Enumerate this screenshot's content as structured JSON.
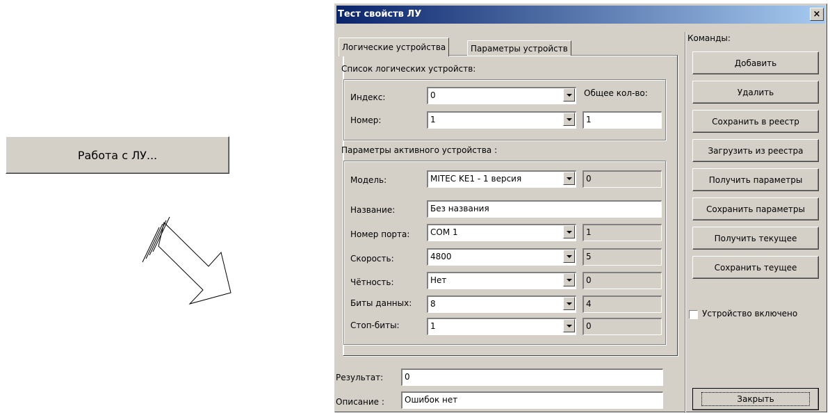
{
  "outer_button": {
    "label": "Работа с ЛУ..."
  },
  "window": {
    "title": "Тест свойств ЛУ",
    "close_glyph": "×"
  },
  "tabs": [
    {
      "label": "Логические устройства",
      "active": true
    },
    {
      "label": "Параметры устройств",
      "active": false
    }
  ],
  "device_list": {
    "title": "Список логических устройств:",
    "index_label": "Индекс:",
    "index_value": "0",
    "number_label": "Номер:",
    "number_value": "1",
    "total_label": "Общее кол-во:",
    "total_value": "1"
  },
  "active_params": {
    "title": "Параметры активного устройства :",
    "model": {
      "label": "Модель:",
      "value": "MITEC KE1 - 1 версия",
      "code": "0"
    },
    "name": {
      "label": "Название:",
      "value": "Без названия"
    },
    "port": {
      "label": "Номер порта:",
      "value": "COM 1",
      "code": "1"
    },
    "speed": {
      "label": "Скорость:",
      "value": "4800",
      "code": "5"
    },
    "parity": {
      "label": "Чётность:",
      "value": "Нет",
      "code": "0"
    },
    "databits": {
      "label": "Биты данных:",
      "value": "8",
      "code": "4"
    },
    "stopbits": {
      "label": "Стоп-биты:",
      "value": "1",
      "code": "0"
    }
  },
  "result": {
    "label": "Результат:",
    "value": "0"
  },
  "description": {
    "label": "Описание :",
    "value": "Ошибок нет"
  },
  "commands": {
    "title": "Команды:",
    "buttons": [
      "Добавить",
      "Удалить",
      "Сохранить в реестр",
      "Загрузить из реестра",
      "Получить параметры",
      "Сохранить параметры",
      "Получить текущее",
      "Сохранить теущее"
    ],
    "checkbox_label": "Устройство включено",
    "checkbox_checked": false,
    "close_label": "Закрыть"
  }
}
